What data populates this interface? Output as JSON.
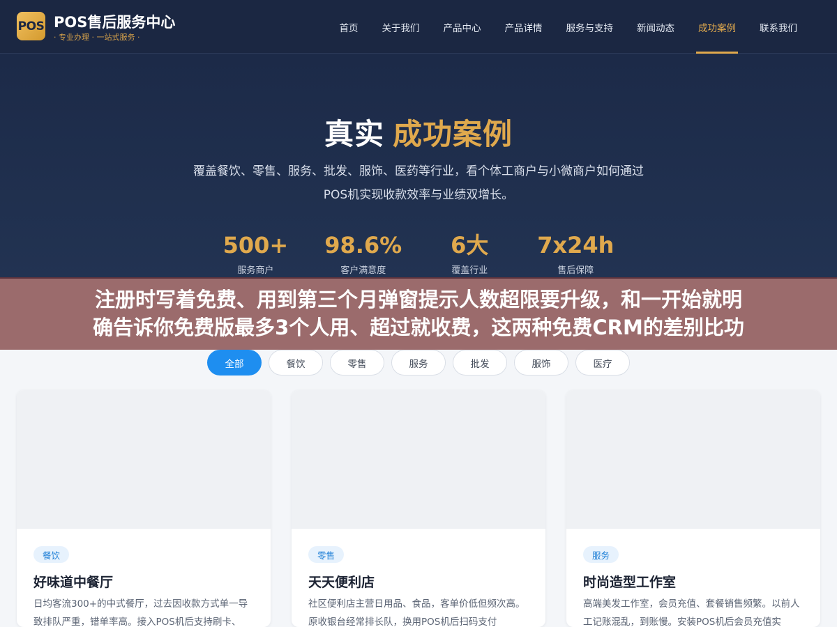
{
  "brand": {
    "logo_text": "POS",
    "name": "POS售后服务中心",
    "subtitle": "· 专业办理 · 一站式服务 ·"
  },
  "nav": {
    "items": [
      {
        "label": "首页"
      },
      {
        "label": "关于我们"
      },
      {
        "label": "产品中心"
      },
      {
        "label": "产品详情"
      },
      {
        "label": "服务与支持"
      },
      {
        "label": "新闻动态"
      },
      {
        "label": "成功案例",
        "active": true
      },
      {
        "label": "联系我们"
      }
    ]
  },
  "hero": {
    "title_plain": "真实",
    "title_highlight": "成功案例",
    "description": "覆盖餐饮、零售、服务、批发、服饰、医药等行业，看个体工商户与小微商户如何通过POS机实现收款效率与业绩双增长。",
    "stats": [
      {
        "value": "500+",
        "label": "服务商户"
      },
      {
        "value": "98.6%",
        "label": "客户满意度"
      },
      {
        "value": "6大",
        "label": "覆盖行业"
      },
      {
        "value": "7x24h",
        "label": "售后保障"
      }
    ]
  },
  "banner": {
    "line1": "注册时写着免费、用到第三个月弹窗提示人数超限要升级，和一开始就明",
    "line2": "确告诉你免费版最多3个人用、超过就收费，这两种免费CRM的差别比功"
  },
  "filters": [
    {
      "label": "全部",
      "active": true
    },
    {
      "label": "餐饮"
    },
    {
      "label": "零售"
    },
    {
      "label": "服务"
    },
    {
      "label": "批发"
    },
    {
      "label": "服饰"
    },
    {
      "label": "医疗"
    }
  ],
  "cards": [
    {
      "tag": "餐饮",
      "title": "好味道中餐厅",
      "desc": "日均客流300+的中式餐厅，过去因收款方式单一导致排队严重，错单率高。接入POS机后支持刷卡、"
    },
    {
      "tag": "零售",
      "title": "天天便利店",
      "desc": "社区便利店主营日用品、食品，客单价低但频次高。原收银台经常排长队，换用POS机后扫码支付"
    },
    {
      "tag": "服务",
      "title": "时尚造型工作室",
      "desc": "高端美发工作室，会员充值、套餐销售频繁。以前人工记账混乱，到账慢。安装POS机后会员充值实"
    }
  ]
}
